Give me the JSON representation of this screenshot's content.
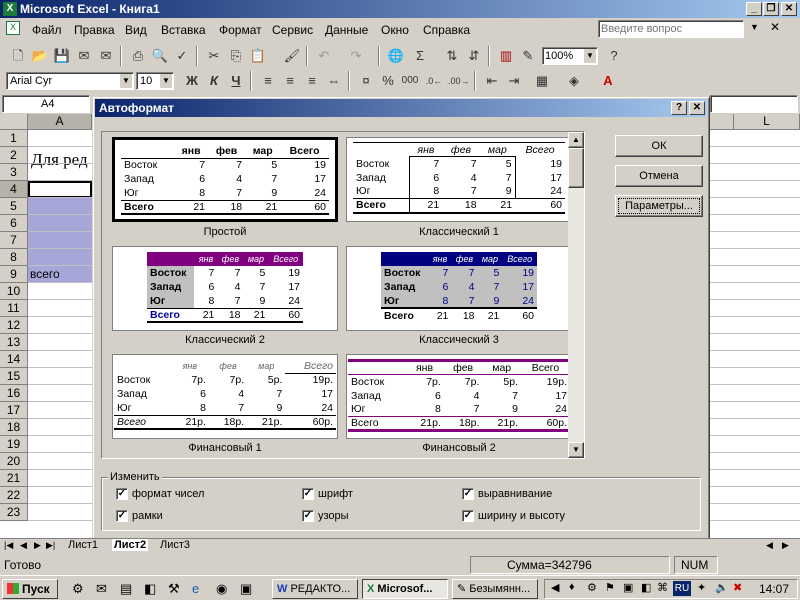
{
  "app": {
    "title": "Microsoft Excel - Книга1"
  },
  "menu": [
    "Файл",
    "Правка",
    "Вид",
    "Вставка",
    "Формат",
    "Сервис",
    "Данные",
    "Окно",
    "Справка"
  ],
  "help_box": {
    "placeholder": "Введите вопрос"
  },
  "toolbar": {
    "zoom": "100%"
  },
  "format_toolbar": {
    "font": "Arial Cyr",
    "size": "10",
    "bold": "Ж",
    "italic": "К",
    "underline": "Ч"
  },
  "name_box": "A4",
  "sheet": {
    "columns": [
      "A",
      "L"
    ],
    "rows": [
      "1",
      "2",
      "3",
      "4",
      "5",
      "6",
      "7",
      "8",
      "9",
      "10",
      "11",
      "12",
      "13",
      "14",
      "15",
      "16",
      "17",
      "18",
      "19",
      "20",
      "21",
      "22",
      "23"
    ],
    "a2_text": "Для ред",
    "a9_text": "всего",
    "selection_color": "#a6a6d8"
  },
  "dialog": {
    "title": "Автоформат",
    "ok": "ОК",
    "cancel": "Отмена",
    "options": "Параметры...",
    "group_label": "Изменить",
    "checkboxes": [
      {
        "label": "формат чисел",
        "checked": true
      },
      {
        "label": "шрифт",
        "checked": true
      },
      {
        "label": "выравнивание",
        "checked": true
      },
      {
        "label": "рамки",
        "checked": true
      },
      {
        "label": "узоры",
        "checked": true
      },
      {
        "label": "ширину и высоту",
        "checked": true
      }
    ],
    "formats": [
      {
        "name": "Простой"
      },
      {
        "name": "Классический 1"
      },
      {
        "name": "Классический 2"
      },
      {
        "name": "Классический 3"
      },
      {
        "name": "Финансовый 1"
      },
      {
        "name": "Финансовый 2"
      }
    ],
    "sample": {
      "headers": [
        "янв",
        "фев",
        "мар",
        "Всего"
      ],
      "rows": [
        {
          "label": "Восток",
          "values": [
            "7",
            "7",
            "5",
            "19"
          ]
        },
        {
          "label": "Запад",
          "values": [
            "6",
            "4",
            "7",
            "17"
          ]
        },
        {
          "label": "Юг",
          "values": [
            "8",
            "7",
            "9",
            "24"
          ]
        }
      ],
      "total": {
        "label": "Всего",
        "values": [
          "21",
          "18",
          "21",
          "60"
        ]
      },
      "fin_rows": [
        {
          "label": "Восток",
          "values": [
            "7р.",
            "7р.",
            "5р.",
            "19р."
          ]
        },
        {
          "label": "Запад",
          "values": [
            "6",
            "4",
            "7",
            "17"
          ]
        },
        {
          "label": "Юг",
          "values": [
            "8",
            "7",
            "9",
            "24"
          ]
        }
      ],
      "fin_total": {
        "label": "Всего",
        "values": [
          "21р.",
          "18р.",
          "21р.",
          "60р."
        ]
      }
    }
  },
  "sheet_tabs": [
    "Лист1",
    "Лист2",
    "Лист3"
  ],
  "status": {
    "ready": "Готово",
    "sum": "Сумма=342796",
    "num": "NUM"
  },
  "taskbar": {
    "start": "Пуск",
    "tasks": [
      "РЕДАКТО...",
      "Microsof...",
      "Безымянн..."
    ],
    "lang": "RU",
    "clock": "14:07"
  }
}
